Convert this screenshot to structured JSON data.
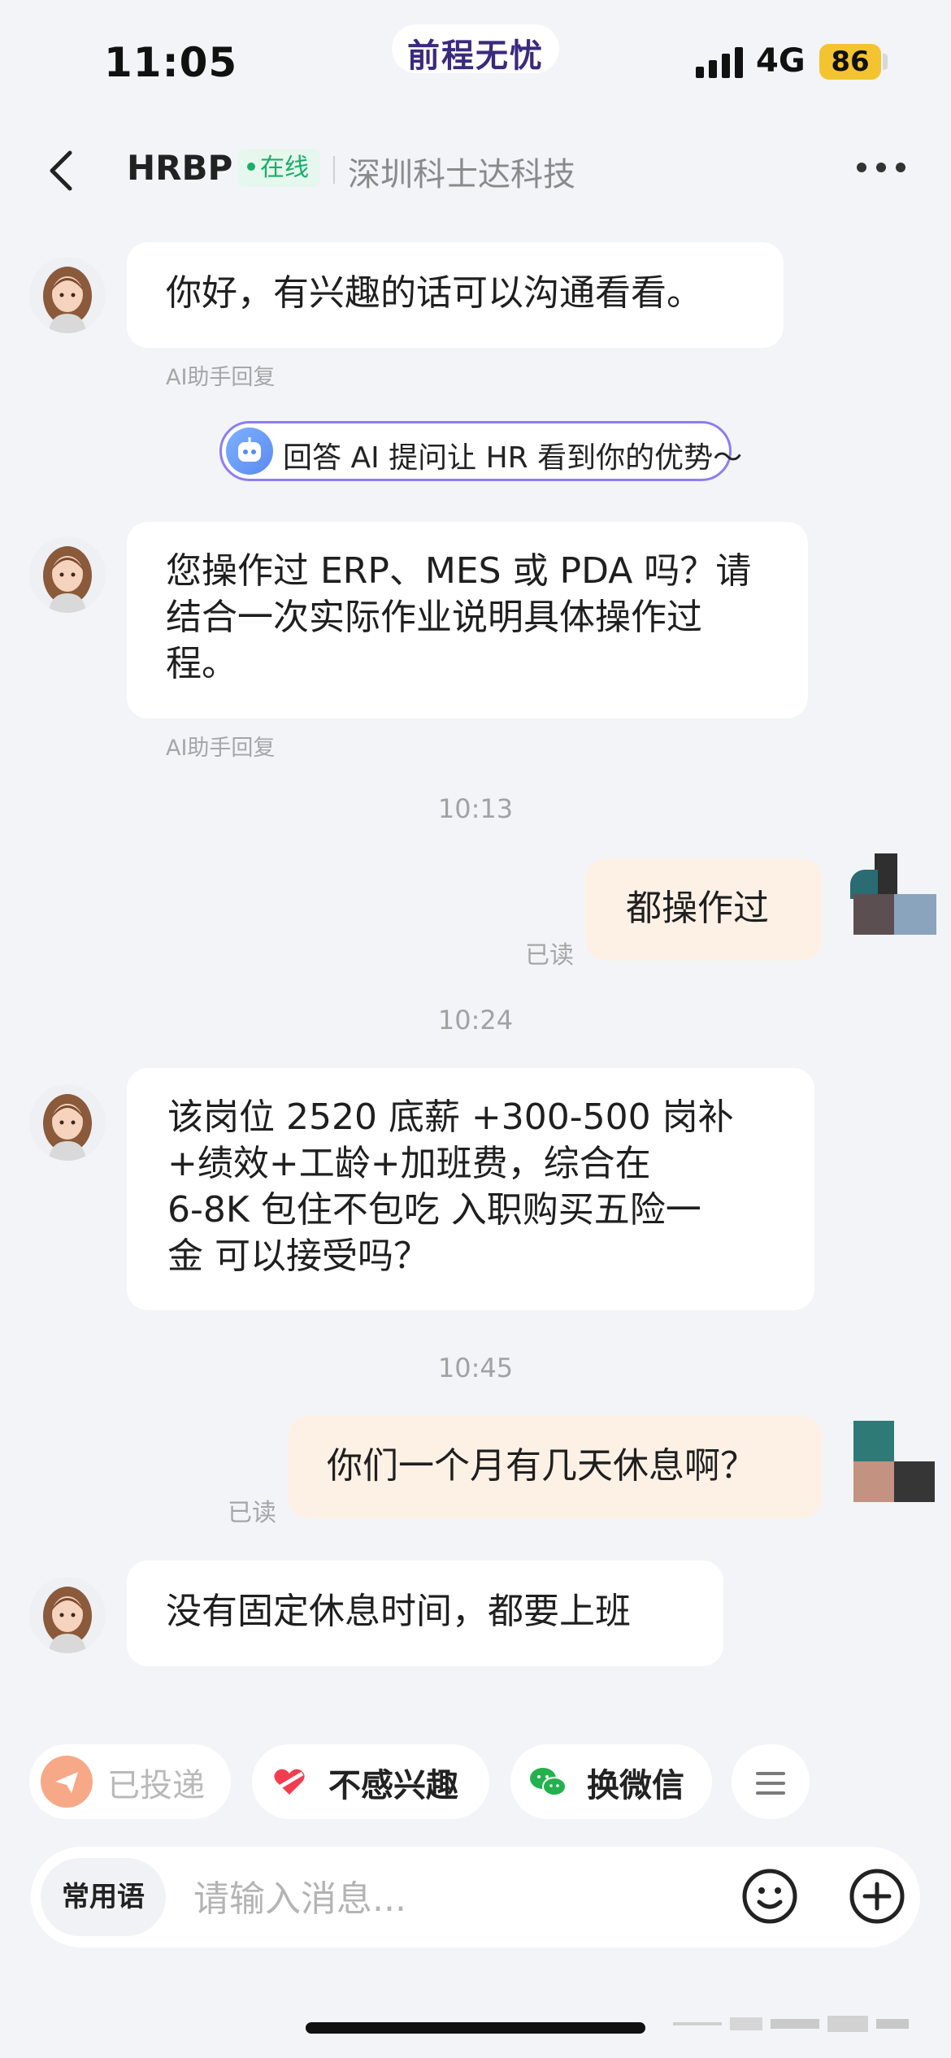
{
  "status_bar": {
    "time": "11:05",
    "brand": "前程无忧",
    "network": "4G",
    "battery": "86"
  },
  "nav": {
    "title": "HRBP",
    "status": "在线",
    "company": "深圳科士达科技"
  },
  "ai_prompt": "回答 AI 提问让 HR 看到你的优势～",
  "messages": [
    {
      "from": "hr",
      "text": "你好，有兴趣的话可以沟通看看。",
      "note": "AI助手回复"
    },
    {
      "from": "hr",
      "lines": [
        "您操作过 ERP、MES 或 PDA 吗？请",
        "结合一次实际作业说明具体操作过",
        "程。"
      ],
      "note": "AI助手回复"
    },
    {
      "timestamp": "10:13"
    },
    {
      "from": "me",
      "text": "都操作过",
      "read": "已读"
    },
    {
      "timestamp": "10:24"
    },
    {
      "from": "hr",
      "lines": [
        "该岗位 2520 底薪 +300-500 岗补",
        "+绩效+工龄+加班费，综合在",
        "6-8K 包住不包吃  入职购买五险一",
        "金 可以接受吗？"
      ]
    },
    {
      "timestamp": "10:45"
    },
    {
      "from": "me",
      "text": "你们一个月有几天休息啊？",
      "read": "已读"
    },
    {
      "from": "hr",
      "text": "没有固定休息时间，都要上班"
    }
  ],
  "actions": [
    {
      "label": "已投递",
      "icon": "send-icon",
      "color": "#f7a987",
      "dim": true
    },
    {
      "label": "不感兴趣",
      "icon": "heart-cross-icon",
      "color": "#f23d4f"
    },
    {
      "label": "换微信",
      "icon": "wechat-icon",
      "color": "#22b14c"
    }
  ],
  "input": {
    "phrases": "常用语",
    "placeholder": "请输入消息..."
  }
}
